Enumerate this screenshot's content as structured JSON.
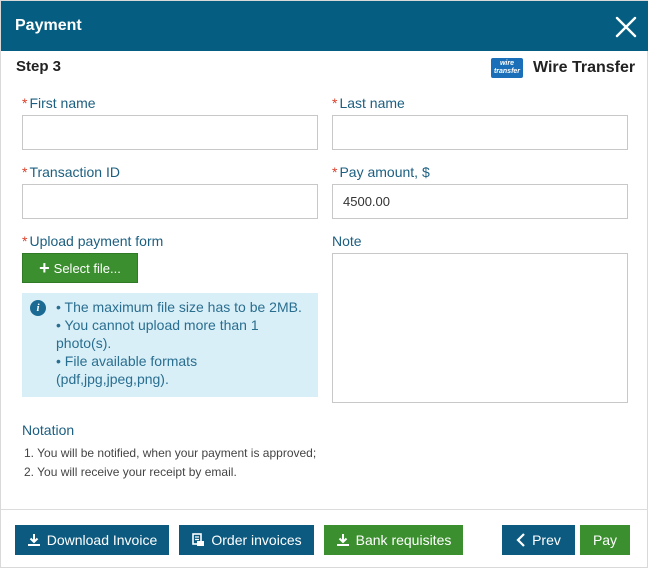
{
  "header": {
    "title": "Payment"
  },
  "step": "Step 3",
  "method": {
    "logo_text": "wire transfer",
    "name": "Wire Transfer"
  },
  "form": {
    "first_name": {
      "label": "First name",
      "value": ""
    },
    "last_name": {
      "label": "Last name",
      "value": ""
    },
    "transaction_id": {
      "label": "Transaction ID",
      "value": ""
    },
    "pay_amount": {
      "label": "Pay amount, $",
      "value": "4500.00"
    },
    "upload": {
      "label": "Upload payment form",
      "button": "Select file..."
    },
    "note": {
      "label": "Note",
      "value": ""
    },
    "required_mark": "*"
  },
  "info": {
    "icon": "i",
    "lines": [
      "• The maximum file size has to be 2MB.",
      "• You cannot upload more than 1",
      "photo(s).",
      "• File available formats",
      "(pdf,jpg,jpeg,png)."
    ]
  },
  "notation": {
    "title": "Notation",
    "items": [
      "1. You will be notified, when your payment is approved;",
      "2. You will receive your receipt by email."
    ]
  },
  "footer": {
    "download_invoice": "Download Invoice",
    "order_invoices": "Order invoices",
    "bank_requisites": "Bank requisites",
    "prev": "Prev",
    "pay": "Pay"
  },
  "colors": {
    "header": "#055e81",
    "primary_blue": "#0c5a80",
    "success_green": "#3c8f2f",
    "required_red": "#d9412b",
    "info_bg": "#d8eff8"
  }
}
